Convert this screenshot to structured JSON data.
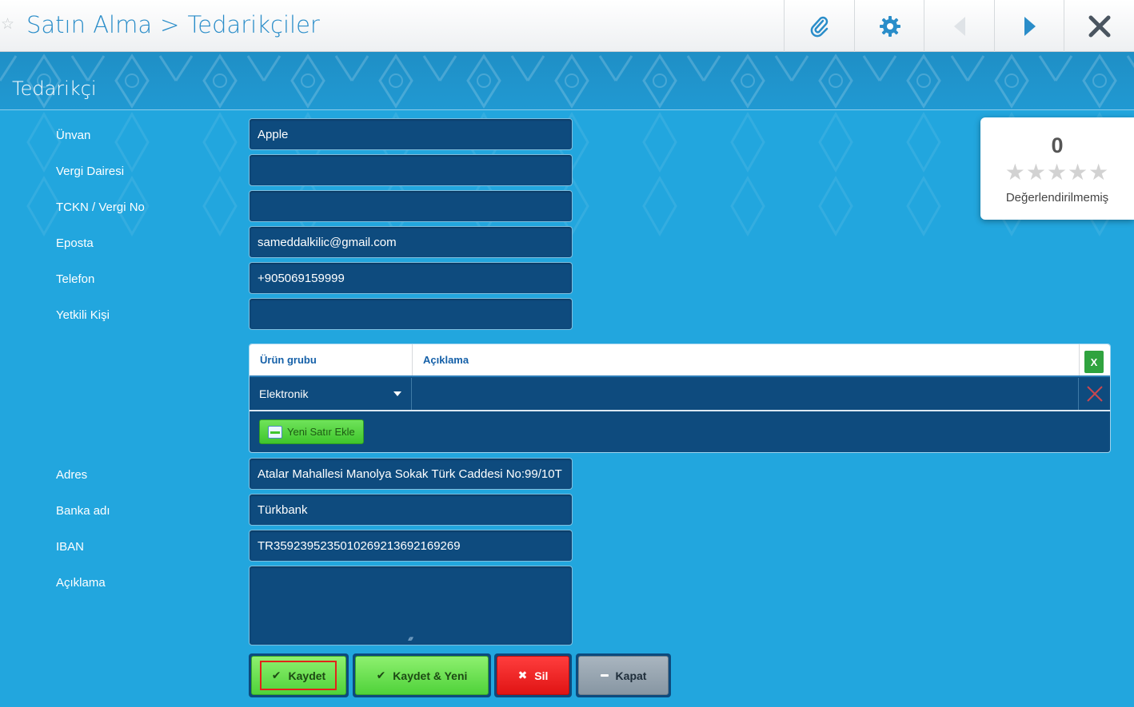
{
  "header": {
    "breadcrumb_root": "Satın Alma",
    "breadcrumb_separator": ">",
    "breadcrumb_current": "Tedarikçiler",
    "toolbar_icons": [
      "attachment-icon",
      "gear-icon",
      "previous-icon",
      "next-icon",
      "close-icon"
    ]
  },
  "section_title": "Tedarikçi",
  "form": {
    "unvan": {
      "label": "Ünvan",
      "value": "Apple"
    },
    "vergi_dairesi": {
      "label": "Vergi Dairesi",
      "value": ""
    },
    "tckn": {
      "label": "TCKN / Vergi No",
      "value": ""
    },
    "eposta": {
      "label": "Eposta",
      "value": "sameddalkilic@gmail.com"
    },
    "telefon": {
      "label": "Telefon",
      "value": "+905069159999"
    },
    "yetkili": {
      "label": "Yetkili Kişi",
      "value": ""
    },
    "adres": {
      "label": "Adres",
      "value": "Atalar Mahallesi Manolya Sokak Türk Caddesi No:99/10T"
    },
    "banka": {
      "label": "Banka adı",
      "value": "Türkbank"
    },
    "iban": {
      "label": "IBAN",
      "value": "TR359239523501026921369216​9269"
    },
    "aciklama": {
      "label": "Açıklama",
      "value": ""
    }
  },
  "rating": {
    "score": "0",
    "stars_filled": 0,
    "stars_total": 5,
    "status": "Değerlendirilmemiş"
  },
  "grid": {
    "columns": [
      "Ürün grubu",
      "Açıklama"
    ],
    "excel_label": "X",
    "rows": [
      {
        "urun_grubu": "Elektronik",
        "aciklama": ""
      }
    ],
    "add_row_label": "Yeni Satır Ekle"
  },
  "buttons": {
    "save": "Kaydet",
    "save_new": "Kaydet & Yeni",
    "delete": "Sil",
    "close": "Kapat"
  },
  "colors": {
    "background": "#22a6de",
    "field_bg": "#0e4b7e",
    "accent": "#2a8dc9",
    "save_green": "#4fd23a",
    "delete_red": "#e01414",
    "close_gray": "#8796a3"
  }
}
